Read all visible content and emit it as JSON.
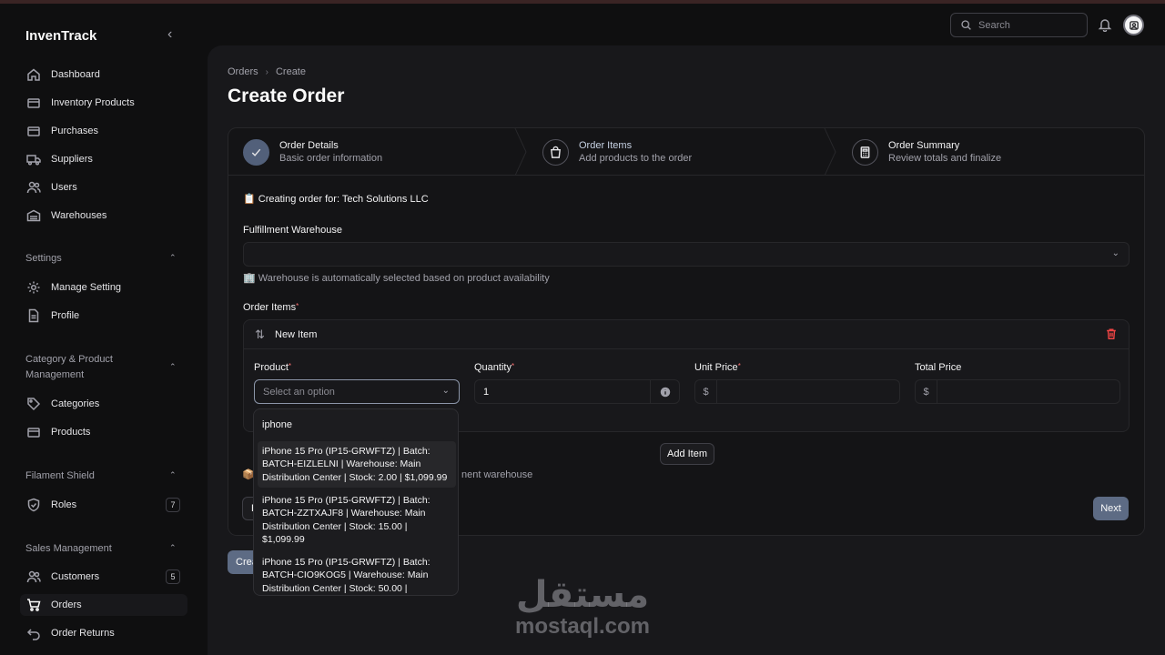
{
  "app": {
    "brand": "InvenTrack"
  },
  "topbar": {
    "search_placeholder": "Search"
  },
  "sidebar": {
    "main_items": [
      {
        "label": "Dashboard",
        "icon": "home-icon"
      },
      {
        "label": "Inventory Products",
        "icon": "box-icon"
      },
      {
        "label": "Purchases",
        "icon": "box-icon"
      },
      {
        "label": "Suppliers",
        "icon": "truck-icon"
      },
      {
        "label": "Users",
        "icon": "users-icon"
      },
      {
        "label": "Warehouses",
        "icon": "warehouse-icon"
      }
    ],
    "settings": {
      "title": "Settings",
      "items": [
        {
          "label": "Manage Setting",
          "icon": "gear-icon"
        },
        {
          "label": "Profile",
          "icon": "document-icon"
        }
      ]
    },
    "catalog": {
      "title": "Category & Product Management",
      "items": [
        {
          "label": "Categories",
          "icon": "tag-icon"
        },
        {
          "label": "Products",
          "icon": "box-icon"
        }
      ]
    },
    "shield": {
      "title": "Filament Shield",
      "items": [
        {
          "label": "Roles",
          "icon": "shield-icon",
          "badge": "7"
        }
      ]
    },
    "sales": {
      "title": "Sales Management",
      "items": [
        {
          "label": "Customers",
          "icon": "users-icon",
          "badge": "5"
        },
        {
          "label": "Orders",
          "icon": "cart-icon",
          "active": true
        },
        {
          "label": "Order Returns",
          "icon": "return-icon"
        }
      ]
    }
  },
  "page": {
    "breadcrumb": [
      "Orders",
      "Create"
    ],
    "title": "Create Order"
  },
  "wizard": {
    "steps": [
      {
        "title": "Order Details",
        "subtitle": "Basic order information",
        "state": "complete"
      },
      {
        "title": "Order Items",
        "subtitle": "Add products to the order",
        "state": "current"
      },
      {
        "title": "Order Summary",
        "subtitle": "Review totals and finalize",
        "state": "upcoming"
      }
    ]
  },
  "form": {
    "creating_for": "📋 Creating order for: Tech Solutions LLC",
    "warehouse_label": "Fulfillment Warehouse",
    "warehouse_value": "",
    "warehouse_hint": "🏢 Warehouse is automatically selected based on product availability",
    "items_label": "Order Items",
    "item": {
      "header": "New Item",
      "product_label": "Product",
      "product_placeholder": "Select an option",
      "quantity_label": "Quantity",
      "quantity_value": "1",
      "unit_price_label": "Unit Price",
      "unit_price_prefix": "$",
      "total_price_label": "Total Price",
      "total_price_prefix": "$"
    },
    "add_item": "Add Item",
    "note_tail": "nent warehouse",
    "note_icon": "📦",
    "back_partial": "B",
    "next": "Next",
    "create_partial": "Crea"
  },
  "dropdown": {
    "search_value": "iphone",
    "options": [
      "iPhone 15 Pro (IP15-GRWFTZ) | Batch: BATCH-EIZLELNI | Warehouse: Main Distribution Center | Stock: 2.00 | $1,099.99",
      "iPhone 15 Pro (IP15-GRWFTZ) | Batch: BATCH-ZZTXAJF8 | Warehouse: Main Distribution Center | Stock: 15.00 | $1,099.99",
      "iPhone 15 Pro (IP15-GRWFTZ) | Batch: BATCH-CIO9KOG5 | Warehouse: Main Distribution Center | Stock: 50.00 |"
    ]
  },
  "watermark": {
    "arabic": "مستقل",
    "latin": "mostaql.com"
  },
  "colors": {
    "accent": "#5d6b84",
    "danger": "#ef4444",
    "required": "#f87171"
  }
}
